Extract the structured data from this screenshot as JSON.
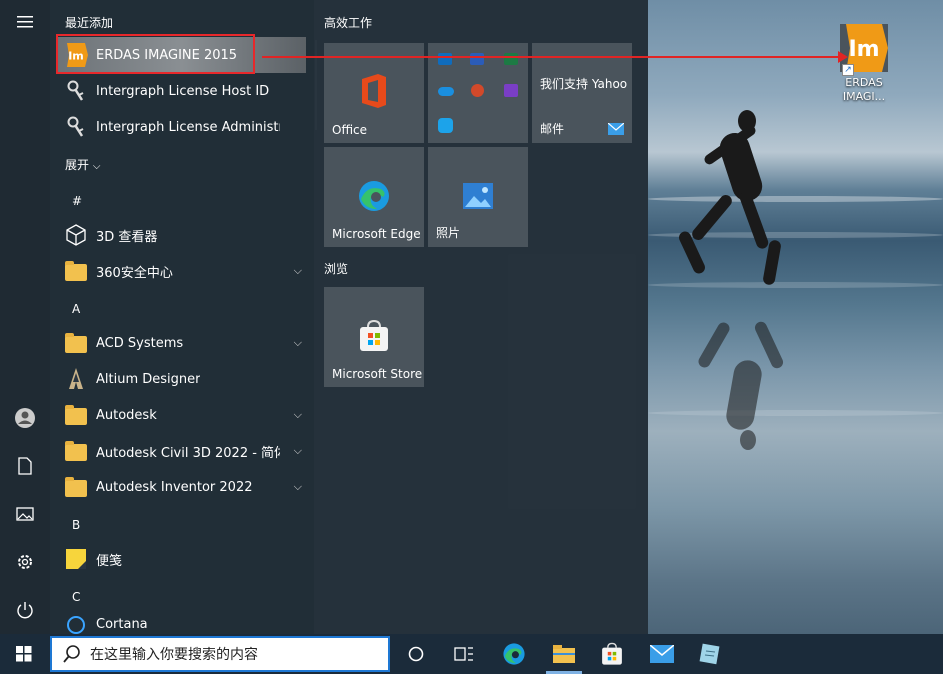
{
  "applist": {
    "recent_header": "最近添加",
    "recent": [
      {
        "label": "ERDAS IMAGINE 2015"
      },
      {
        "label": "Intergraph License Host ID"
      },
      {
        "label": "Intergraph License Administration"
      }
    ],
    "expand_label": "展开",
    "letters": {
      "hash": "#",
      "a": "A",
      "b": "B",
      "c": "C"
    },
    "apps": [
      {
        "label": "3D 查看器"
      },
      {
        "label": "360安全中心"
      },
      {
        "label": "ACD Systems"
      },
      {
        "label": "Altium Designer"
      },
      {
        "label": "Autodesk"
      },
      {
        "label": "Autodesk Civil 3D 2022 - 简体..."
      },
      {
        "label": "Autodesk Inventor 2022"
      },
      {
        "label": "便笺"
      },
      {
        "label": "Cortana"
      }
    ]
  },
  "tiles": {
    "group1": "高效工作",
    "group2": "浏览",
    "office": "Office",
    "yahoo": "我们支持 Yahoo",
    "mail": "邮件",
    "edge": "Microsoft Edge",
    "photos": "照片",
    "store": "Microsoft Store"
  },
  "desktop": {
    "icon_text": "Im",
    "icon_label_1": "ERDAS",
    "icon_label_2": "IMAGI..."
  },
  "app_icon_text": "Im",
  "search": {
    "placeholder": "在这里输入你要搜索的内容"
  },
  "colors": {
    "accent": "#1e78d4",
    "erdas_orange": "#f09a16",
    "highlight": "#e8282b"
  }
}
